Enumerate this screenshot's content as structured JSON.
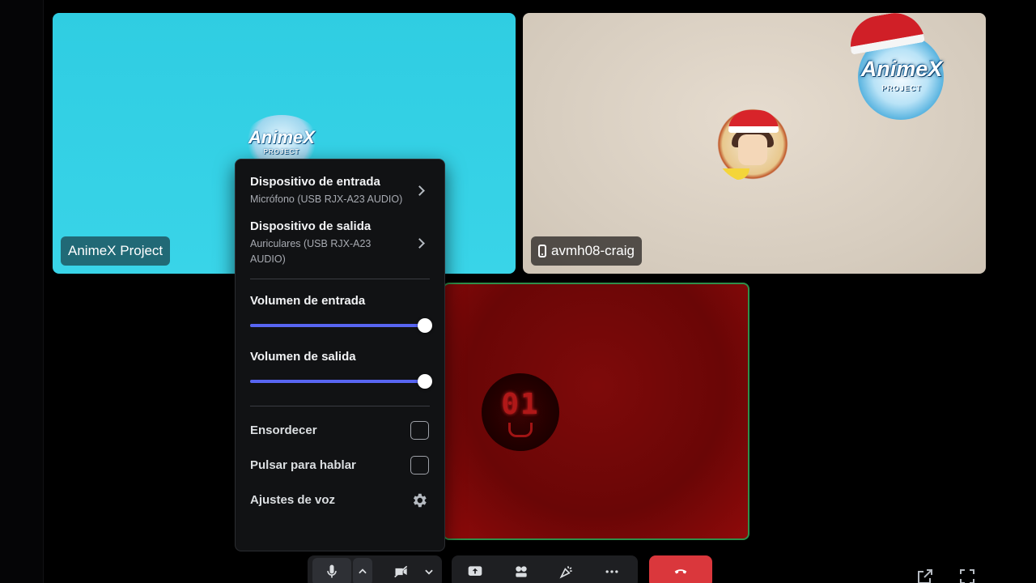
{
  "tiles": {
    "animex": {
      "name": "AnimeX Project",
      "logo_text": "AnimeX",
      "logo_sub": "PROJECT"
    },
    "craig": {
      "name": "avmh08-craig"
    },
    "corner_logo": {
      "word": "AnimeX",
      "sub": "PROJECT"
    },
    "red": {
      "avatar_text": "01"
    }
  },
  "popup": {
    "input_device": {
      "title": "Dispositivo de entrada",
      "value": "Micrófono (USB RJX-A23 AUDIO)"
    },
    "output_device": {
      "title": "Dispositivo de salida",
      "value": "Auriculares (USB RJX-A23 AUDIO)"
    },
    "input_volume": {
      "label": "Volumen de entrada",
      "level": 1.0
    },
    "output_volume": {
      "label": "Volumen de salida",
      "level": 1.0
    },
    "deafen": {
      "label": "Ensordecer",
      "checked": false
    },
    "push_to_talk": {
      "label": "Pulsar para hablar",
      "checked": false
    },
    "voice_settings": {
      "label": "Ajustes de voz"
    }
  },
  "colors": {
    "accent": "#5865f2",
    "danger": "#da373c",
    "popup_bg": "#111214",
    "speaking_border": "#2e8f4a"
  },
  "icons": [
    "microphone-icon",
    "chevron-up-icon",
    "camera-off-icon",
    "chevron-down-icon",
    "screen-share-icon",
    "activities-icon",
    "soundboard-icon",
    "more-icon",
    "hang-up-icon",
    "popout-icon",
    "fullscreen-icon",
    "gear-icon",
    "phone-icon"
  ]
}
